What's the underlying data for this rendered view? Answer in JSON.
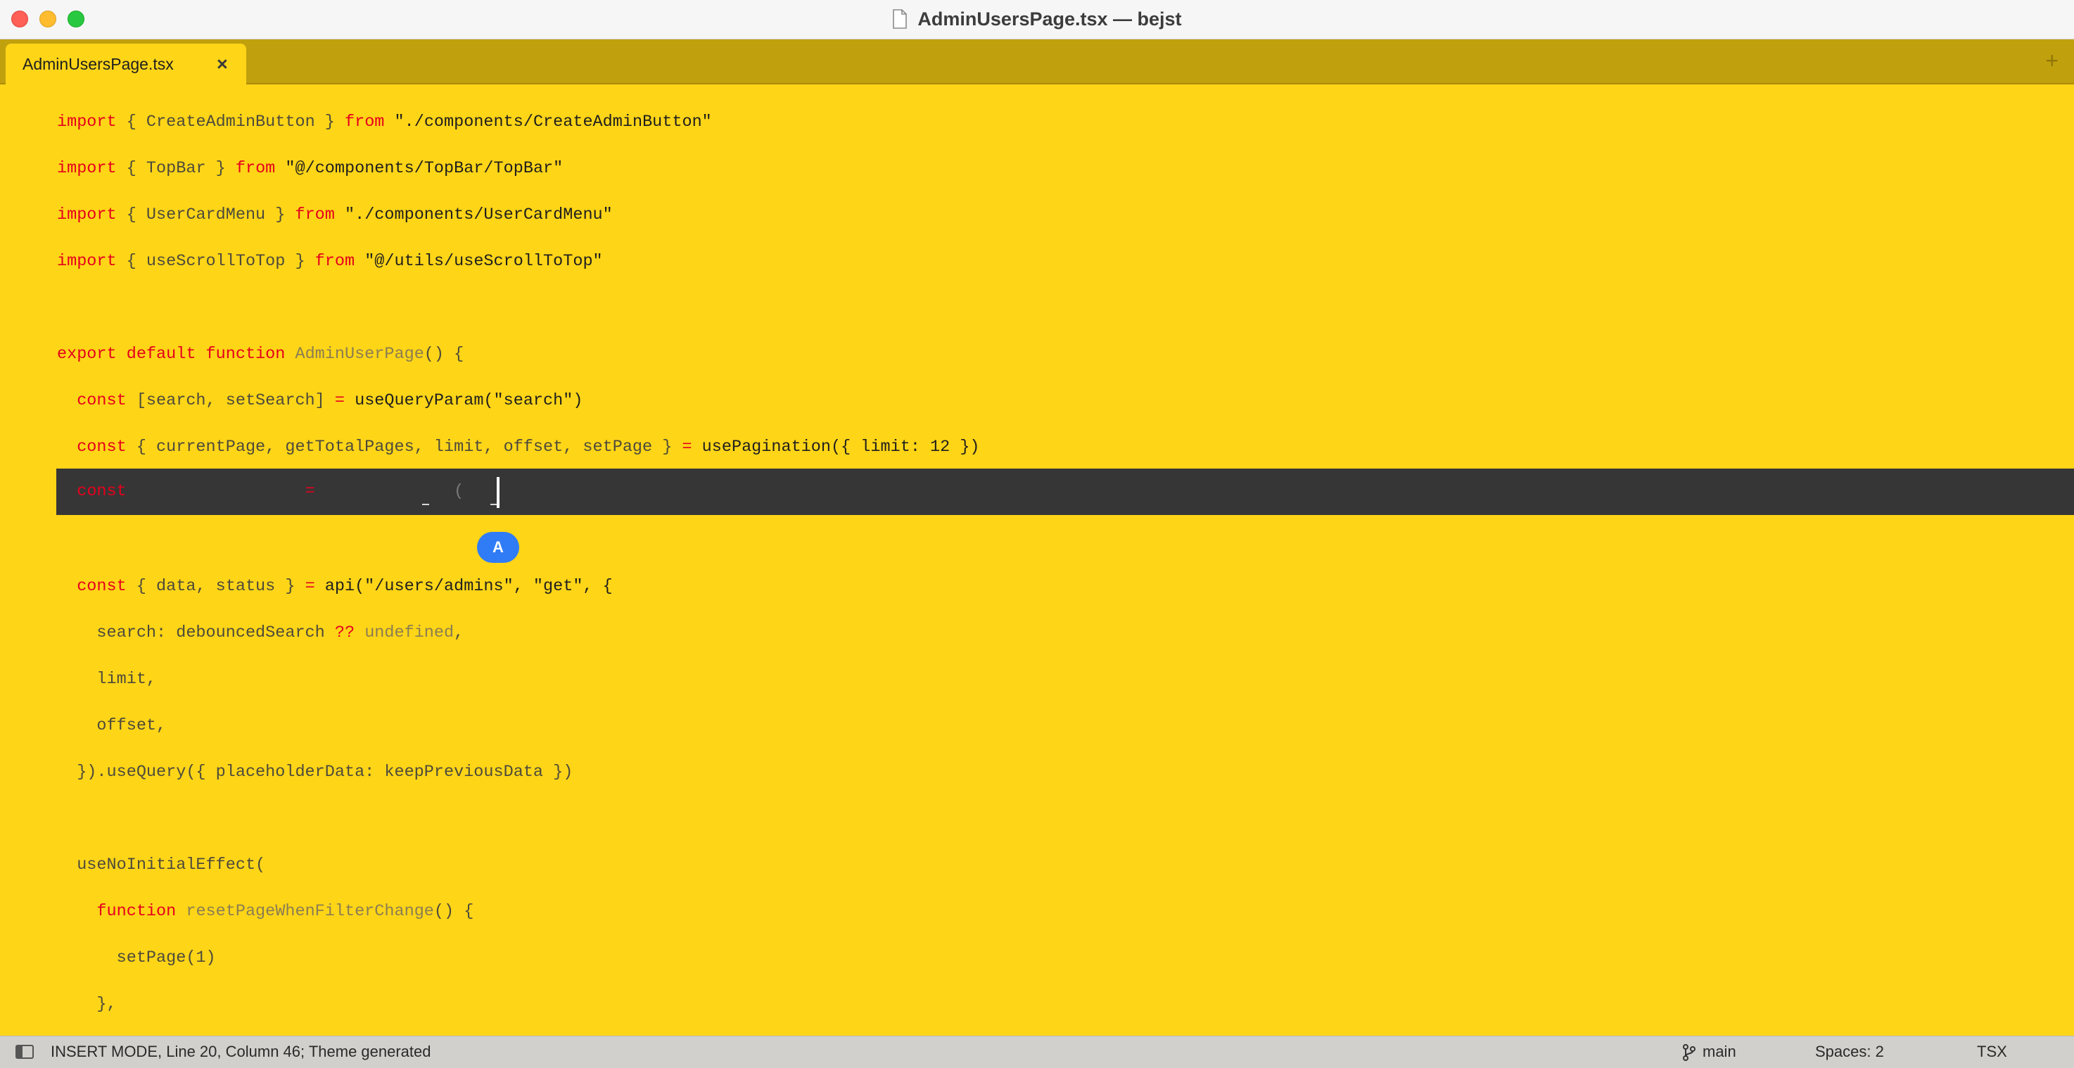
{
  "window": {
    "title": "AdminUsersPage.tsx — bejst"
  },
  "tabs": [
    {
      "label": "AdminUsersPage.tsx",
      "close_glyph": "×"
    }
  ],
  "tab_add_glyph": "+",
  "editor": {
    "current_line_text": {
      "keyword": "const",
      "equals": "=",
      "paren": "("
    },
    "hint_bubble": "A",
    "lines": {
      "l1": {
        "t1": "import",
        "t2": " { CreateAdminButton } ",
        "t3": "from",
        "t4": " \"./components/CreateAdminButton\""
      },
      "l2": {
        "t1": "import",
        "t2": " { TopBar } ",
        "t3": "from",
        "t4": " \"@/components/TopBar/TopBar\""
      },
      "l3": {
        "t1": "import",
        "t2": " { UserCardMenu } ",
        "t3": "from",
        "t4": " \"./components/UserCardMenu\""
      },
      "l4": {
        "t1": "import",
        "t2": " { useScrollToTop } ",
        "t3": "from",
        "t4": " \"@/utils/useScrollToTop\""
      },
      "l5": {
        "t1": "export default function",
        "t2": " AdminUserPage",
        "t3": "() {"
      },
      "l6": {
        "t1": "  const",
        "t2": " [search, setSearch] ",
        "t3": "=",
        "t4": " useQueryParam(\"search\")"
      },
      "l7": {
        "t1": "  const",
        "t2": " { currentPage, getTotalPages, limit, offset, setPage } ",
        "t3": "=",
        "t4": " usePagination({ limit: 12 })"
      },
      "l8": {
        "t1": "  const",
        "t2": " { data, status } ",
        "t3": "=",
        "t4": " api(\"/users/admins\", \"get\", {"
      },
      "l9": {
        "t1": "    search: debouncedSearch ",
        "t2": "??",
        "t3": " undefined",
        "t4": ","
      },
      "l10": {
        "t1": "    limit,"
      },
      "l11": {
        "t1": "    offset,"
      },
      "l12": {
        "t1": "  }).useQuery({ placeholderData: keepPreviousData })"
      },
      "l13": {
        "t1": "  useNoInitialEffect("
      },
      "l14": {
        "t1": "    function",
        "t2": " resetPageWhenFilterChange",
        "t3": "() {"
      },
      "l15": {
        "t1": "      setPage(1)"
      },
      "l16": {
        "t1": "    },"
      }
    }
  },
  "statusbar": {
    "mode_text": "INSERT MODE, Line 20, Column 46; Theme generated",
    "branch": "main",
    "spaces": "Spaces: 2",
    "syntax": "TSX"
  },
  "colors": {
    "background": "#ffd517",
    "tabbar": "#c1a00e",
    "keyword": "#e5001c",
    "current_line": "#363636",
    "accent": "#2f7cf6"
  },
  "icons": [
    "close-window",
    "minimize-window",
    "maximize-window",
    "document-icon",
    "sidebar-toggle-icon",
    "git-branch-icon",
    "plus-icon"
  ]
}
